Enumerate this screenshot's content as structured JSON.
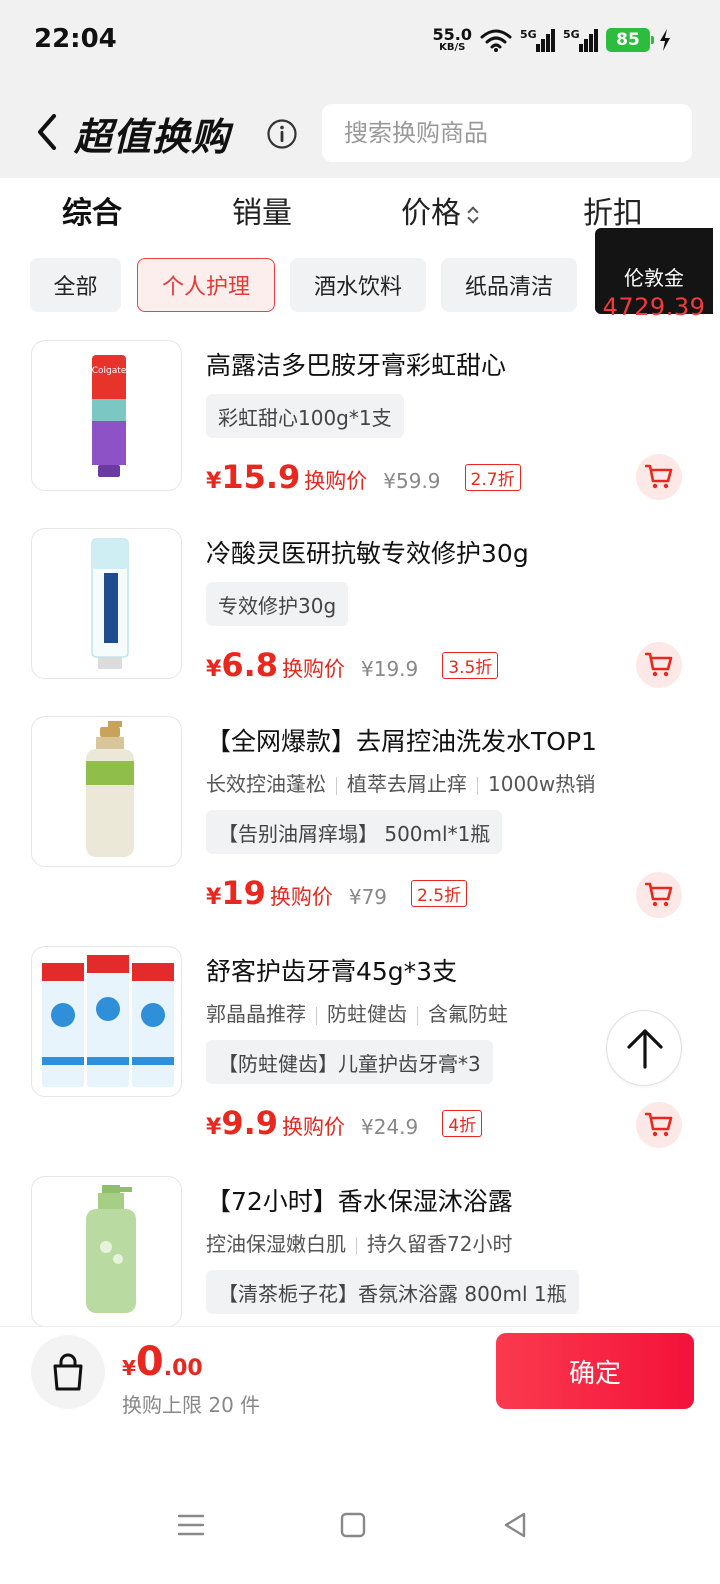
{
  "status_bar": {
    "time": "22:04",
    "net_speed": "55.0",
    "net_unit": "KB/S",
    "sim1": "5G",
    "sim2": "5G",
    "battery": "85"
  },
  "header": {
    "title": "超值换购",
    "search_placeholder": "搜索换购商品"
  },
  "sort_tabs": [
    {
      "label": "综合"
    },
    {
      "label": "销量"
    },
    {
      "label": "价格"
    },
    {
      "label": "折扣"
    }
  ],
  "categories": [
    {
      "label": "全部"
    },
    {
      "label": "个人护理"
    },
    {
      "label": "酒水饮料"
    },
    {
      "label": "纸品清洁"
    }
  ],
  "coins": {
    "label": "伦敦金",
    "value": "4729.39"
  },
  "products": [
    {
      "title": "高露洁多巴胺牙膏彩虹甜心",
      "spec": "彩虹甜心100g*1支",
      "currency": "¥",
      "price": "15.9",
      "price_label": "换购价",
      "original": "¥59.9",
      "discount": "2.7折"
    },
    {
      "title": "冷酸灵医研抗敏专效修护30g",
      "spec": "专效修护30g",
      "currency": "¥",
      "price": "6.8",
      "price_label": "换购价",
      "original": "¥19.9",
      "discount": "3.5折"
    },
    {
      "title": "【全网爆款】去屑控油洗发水TOP1",
      "tags": [
        "长效控油蓬松",
        "植萃去屑止痒",
        "1000w热销"
      ],
      "spec": "【告别油屑痒塌】 500ml*1瓶",
      "currency": "¥",
      "price": "19",
      "price_label": "换购价",
      "original": "¥79",
      "discount": "2.5折"
    },
    {
      "title": "舒客护齿牙膏45g*3支",
      "tags": [
        "郭晶晶推荐",
        "防蛀健齿",
        "含氟防蛀"
      ],
      "spec": "【防蛀健齿】儿童护齿牙膏*3",
      "currency": "¥",
      "price": "9.9",
      "price_label": "换购价",
      "original": "¥24.9",
      "discount": "4折"
    },
    {
      "title": "【72小时】香水保湿沐浴露",
      "tags": [
        "控油保湿嫩白肌",
        "持久留香72小时"
      ],
      "spec": "【清茶栀子花】香氛沐浴露 800ml 1瓶"
    }
  ],
  "bottom": {
    "currency": "¥",
    "total_int": "0",
    "total_dec": ".00",
    "limit": "换购上限 20 件",
    "confirm": "确定"
  },
  "colors": {
    "accent": "#e8281e",
    "confirm_start": "#fb3a4e",
    "confirm_end": "#f4123a",
    "battery": "#2dbd3e"
  }
}
